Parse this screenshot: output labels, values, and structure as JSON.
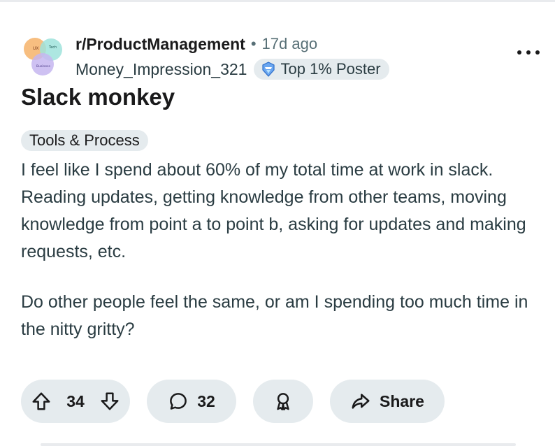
{
  "post": {
    "subreddit": "r/ProductManagement",
    "separator": "•",
    "age": "17d ago",
    "username": "Money_Impression_321",
    "user_flair": "Top 1% Poster",
    "title": "Slack monkey",
    "post_flair": "Tools & Process",
    "body_paragraphs": [
      "I feel like I spend about 60% of my total time at work in slack. Reading updates, getting knowledge from other teams, moving knowledge from point a to point b, asking for updates and making requests, etc.",
      "Do other people feel the same, or am I spending too much time in the nitty gritty?"
    ]
  },
  "avatar": {
    "labels": [
      "UX",
      "Tech",
      "Business"
    ]
  },
  "actions": {
    "upvote_icon": "arrow-up-icon",
    "downvote_icon": "arrow-down-icon",
    "score": "34",
    "comments_icon": "comment-bubble-icon",
    "comments_count": "32",
    "award_icon": "award-icon",
    "share_icon": "share-arrow-icon",
    "share_label": "Share"
  },
  "colors": {
    "pill_background": "#e5ebee",
    "meta_text": "#576f76",
    "text": "#1a1a1b"
  }
}
